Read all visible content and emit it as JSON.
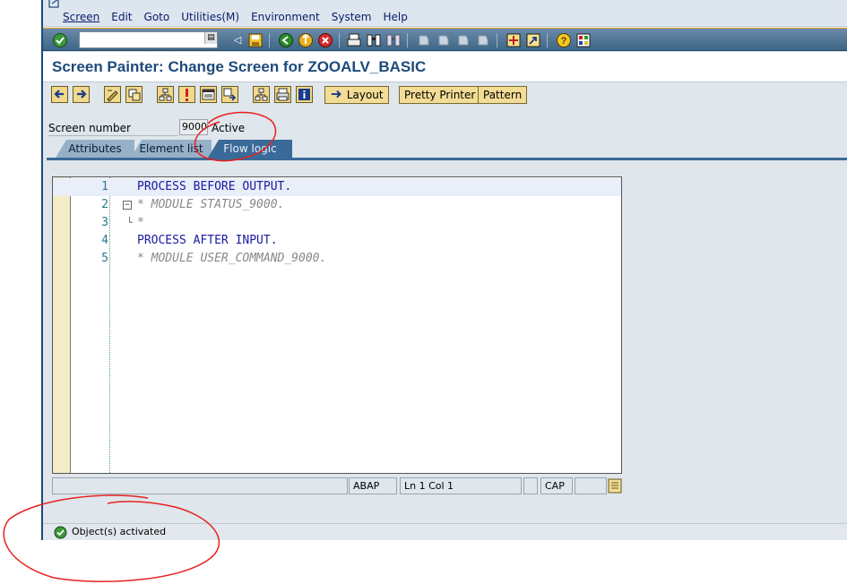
{
  "menubar": {
    "items": [
      {
        "label": "Screen"
      },
      {
        "label": "Edit"
      },
      {
        "label": "Goto"
      },
      {
        "label": "Utilities(M)"
      },
      {
        "label": "Environment"
      },
      {
        "label": "System"
      },
      {
        "label": "Help"
      }
    ]
  },
  "systoolbar": {
    "command_field_value": ""
  },
  "title": "Screen Painter: Change Screen for ZOOALV_BASIC",
  "apptoolbar": {
    "layout_label": "Layout",
    "pretty_printer_label": "Pretty Printer",
    "pattern_label": "Pattern"
  },
  "screen": {
    "number_label": "Screen number",
    "number_value": "9000",
    "status": "Active"
  },
  "tabs": [
    {
      "label": "Attributes",
      "active": false
    },
    {
      "label": "Element list",
      "active": false
    },
    {
      "label": "Flow logic",
      "active": true
    }
  ],
  "editor": {
    "lines": [
      {
        "num": "1",
        "text": "PROCESS BEFORE OUTPUT."
      },
      {
        "num": "2",
        "text": "* MODULE STATUS_9000."
      },
      {
        "num": "3",
        "text": "*"
      },
      {
        "num": "4",
        "text": "PROCESS AFTER INPUT."
      },
      {
        "num": "5",
        "text": "* MODULE USER_COMMAND_9000."
      }
    ],
    "status": {
      "language": "ABAP",
      "position": "Ln  1 Col  1",
      "caps": "CAP"
    }
  },
  "statusbar": {
    "message": "Object(s) activated"
  },
  "colors": {
    "title": "#1e4a7a",
    "keyword": "#1a1aa0",
    "comment": "#888888",
    "annotation": "#e82020"
  }
}
